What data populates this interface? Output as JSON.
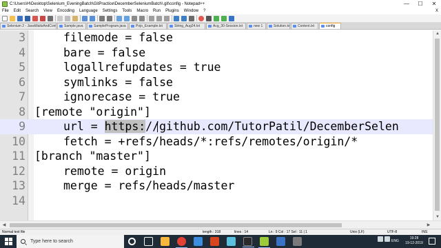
{
  "window": {
    "title": "C:\\Users\\H\\Desktop\\Selenium_EveningBatch\\GitPractice\\DecemberSeleniumBatch\\.git\\config - Notepad++",
    "controls": {
      "minimize": "—",
      "maximize": "☐",
      "close": "✕"
    }
  },
  "menu": {
    "items": [
      "File",
      "Edit",
      "Search",
      "View",
      "Encoding",
      "Language",
      "Settings",
      "Tools",
      "Macro",
      "Run",
      "Plugins",
      "Window",
      "?"
    ],
    "close_glyph": "X"
  },
  "tabs": [
    {
      "label": "Selenium 2 - JavaWaitsAndConfig.txt"
    },
    {
      "label": "Sample.java"
    },
    {
      "label": "SampleProgram.java"
    },
    {
      "label": "Pojo_Example.txt"
    },
    {
      "label": "String_Aug24.txt"
    },
    {
      "label": "Acg_30-Session.txt"
    },
    {
      "label": "new 1"
    },
    {
      "label": "Solution.txt"
    },
    {
      "label": "Content.txt"
    },
    {
      "label": "config",
      "active": true
    }
  ],
  "editor": {
    "lines": [
      {
        "num": "3",
        "text": "filemode = false",
        "indent": true
      },
      {
        "num": "4",
        "text": "bare = false",
        "indent": true
      },
      {
        "num": "5",
        "text": "logallrefupdates = true",
        "indent": true
      },
      {
        "num": "6",
        "text": "symlinks = false",
        "indent": true
      },
      {
        "num": "7",
        "text": "ignorecase = true",
        "indent": true
      },
      {
        "num": "8",
        "text": "[remote \"origin\"]",
        "indent": false
      },
      {
        "num": "9",
        "text_before": "url = ",
        "text_highlight": "https:",
        "text_after": "//github.com/TutorPatil/DecemberSelen",
        "indent": true,
        "current": true
      },
      {
        "num": "10",
        "text": "fetch = +refs/heads/*:refs/remotes/origin/*",
        "indent": true
      },
      {
        "num": "11",
        "text": "[branch \"master\"]",
        "indent": false
      },
      {
        "num": "12",
        "text": "remote = origin",
        "indent": true
      },
      {
        "num": "13",
        "text": "merge = refs/heads/master",
        "indent": true
      },
      {
        "num": "14",
        "text": "",
        "indent": false
      }
    ]
  },
  "statusbar": {
    "file_type": "Normal text file",
    "length": "length : 318",
    "lines": "lines : 14",
    "position": "Ln : 9   Col : 17   Sel : 11 | 1",
    "eol": "Unix (LF)",
    "encoding": "UTF-8",
    "mode": "INS"
  },
  "taskbar": {
    "search_placeholder": "Type here to search",
    "language": "ENG",
    "time": "19:28",
    "date": "19-12-2019"
  }
}
